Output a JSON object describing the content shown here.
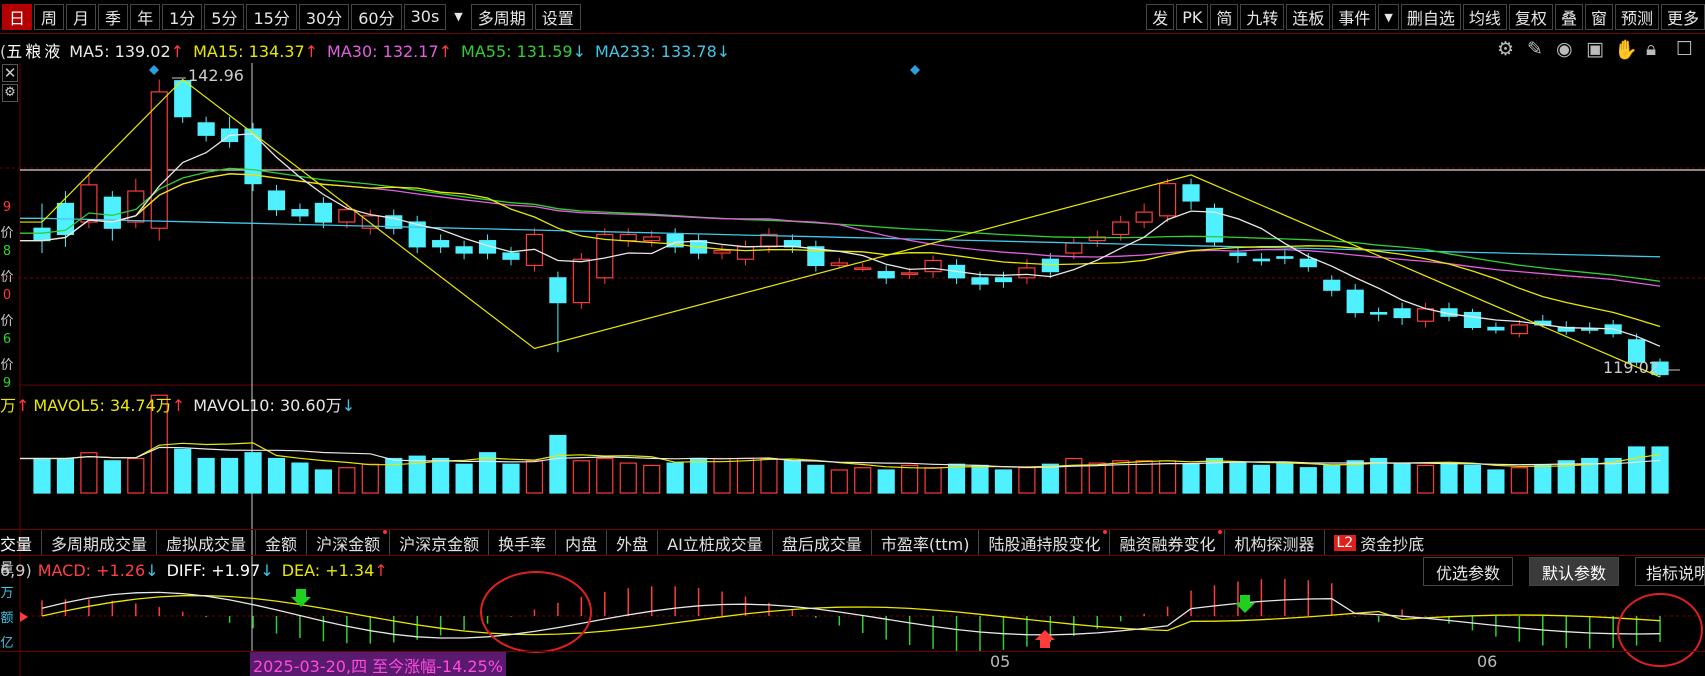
{
  "toolbar": {
    "periods": [
      "日",
      "周",
      "月",
      "季",
      "年",
      "1分",
      "5分",
      "15分",
      "30分",
      "60分",
      "30s"
    ],
    "active_period": "日",
    "dropdown_icon": "caret-down-icon",
    "multi_period": "多周期",
    "settings": "设置",
    "right_items": [
      "发",
      "PK",
      "简",
      "九转",
      "连板",
      "事件"
    ],
    "right_items2": [
      "删自选",
      "均线",
      "复权",
      "叠",
      "窗",
      "预测",
      "更多"
    ]
  },
  "stock": {
    "name_prefix": "(",
    "name": "五粮液",
    "ma_lines": [
      {
        "label": "MA5: 139.02",
        "arrow": "↑",
        "color": "#e8e8e8"
      },
      {
        "label": "MA15: 134.37",
        "arrow": "↑",
        "color": "#e8e800"
      },
      {
        "label": "MA30: 132.17",
        "arrow": "↑",
        "color": "#e060e0"
      },
      {
        "label": "MA55: 131.59",
        "arrow": "↓",
        "color": "#30d030"
      },
      {
        "label": "MA233: 133.78",
        "arrow": "↓",
        "color": "#40c8e8"
      }
    ],
    "high_label": "142.96",
    "low_label": "119.02"
  },
  "volume": {
    "unit_prefix": "万",
    "up_arrow": "↑",
    "mavol5": "MAVOL5: 34.74万",
    "mavol10": "MAVOL10: 30.60万",
    "down_arrow": "↓"
  },
  "indicator_tabs": [
    {
      "label": "交量",
      "dot": false
    },
    {
      "label": "多周期成交量",
      "dot": false
    },
    {
      "label": "虚拟成交量",
      "dot": false
    },
    {
      "label": "金额",
      "dot": false
    },
    {
      "label": "沪深金额",
      "dot": true
    },
    {
      "label": "沪深京金额",
      "dot": false
    },
    {
      "label": "换手率",
      "dot": false
    },
    {
      "label": "内盘",
      "dot": false
    },
    {
      "label": "外盘",
      "dot": false
    },
    {
      "label": "AI立桩成交量",
      "dot": false
    },
    {
      "label": "盘后成交量",
      "dot": false
    },
    {
      "label": "市盈率(ttm)",
      "dot": false
    },
    {
      "label": "陆股通持股变化",
      "dot": true
    },
    {
      "label": "融资融券变化",
      "dot": true
    },
    {
      "label": "机构探测器",
      "dot": false
    }
  ],
  "l2_badge": "L2",
  "funds_tab": "资金抄底",
  "macd": {
    "params": "6,9)",
    "macd": "MACD: +1.26",
    "macd_arrow": "↓",
    "diff": "DIFF: +1.97",
    "diff_arrow": "↓",
    "dea": "DEA: +1.34",
    "dea_arrow": "↑",
    "buttons": [
      "优选参数",
      "默认参数",
      "指标说明"
    ],
    "selected": "默认参数"
  },
  "axis": {
    "date_tag": "2025-03-20,四 至今涨幅-14.25%",
    "months": [
      "05",
      "06"
    ]
  },
  "left_labels": [
    "9",
    "价",
    "8",
    "价",
    "0",
    "价",
    "6",
    "价",
    "9"
  ],
  "left_labels2": [
    "量",
    "万",
    "额",
    "亿"
  ],
  "colors": {
    "up": "#ff3b3b",
    "down": "#4ff0ff",
    "accent_red": "#b30000"
  }
}
